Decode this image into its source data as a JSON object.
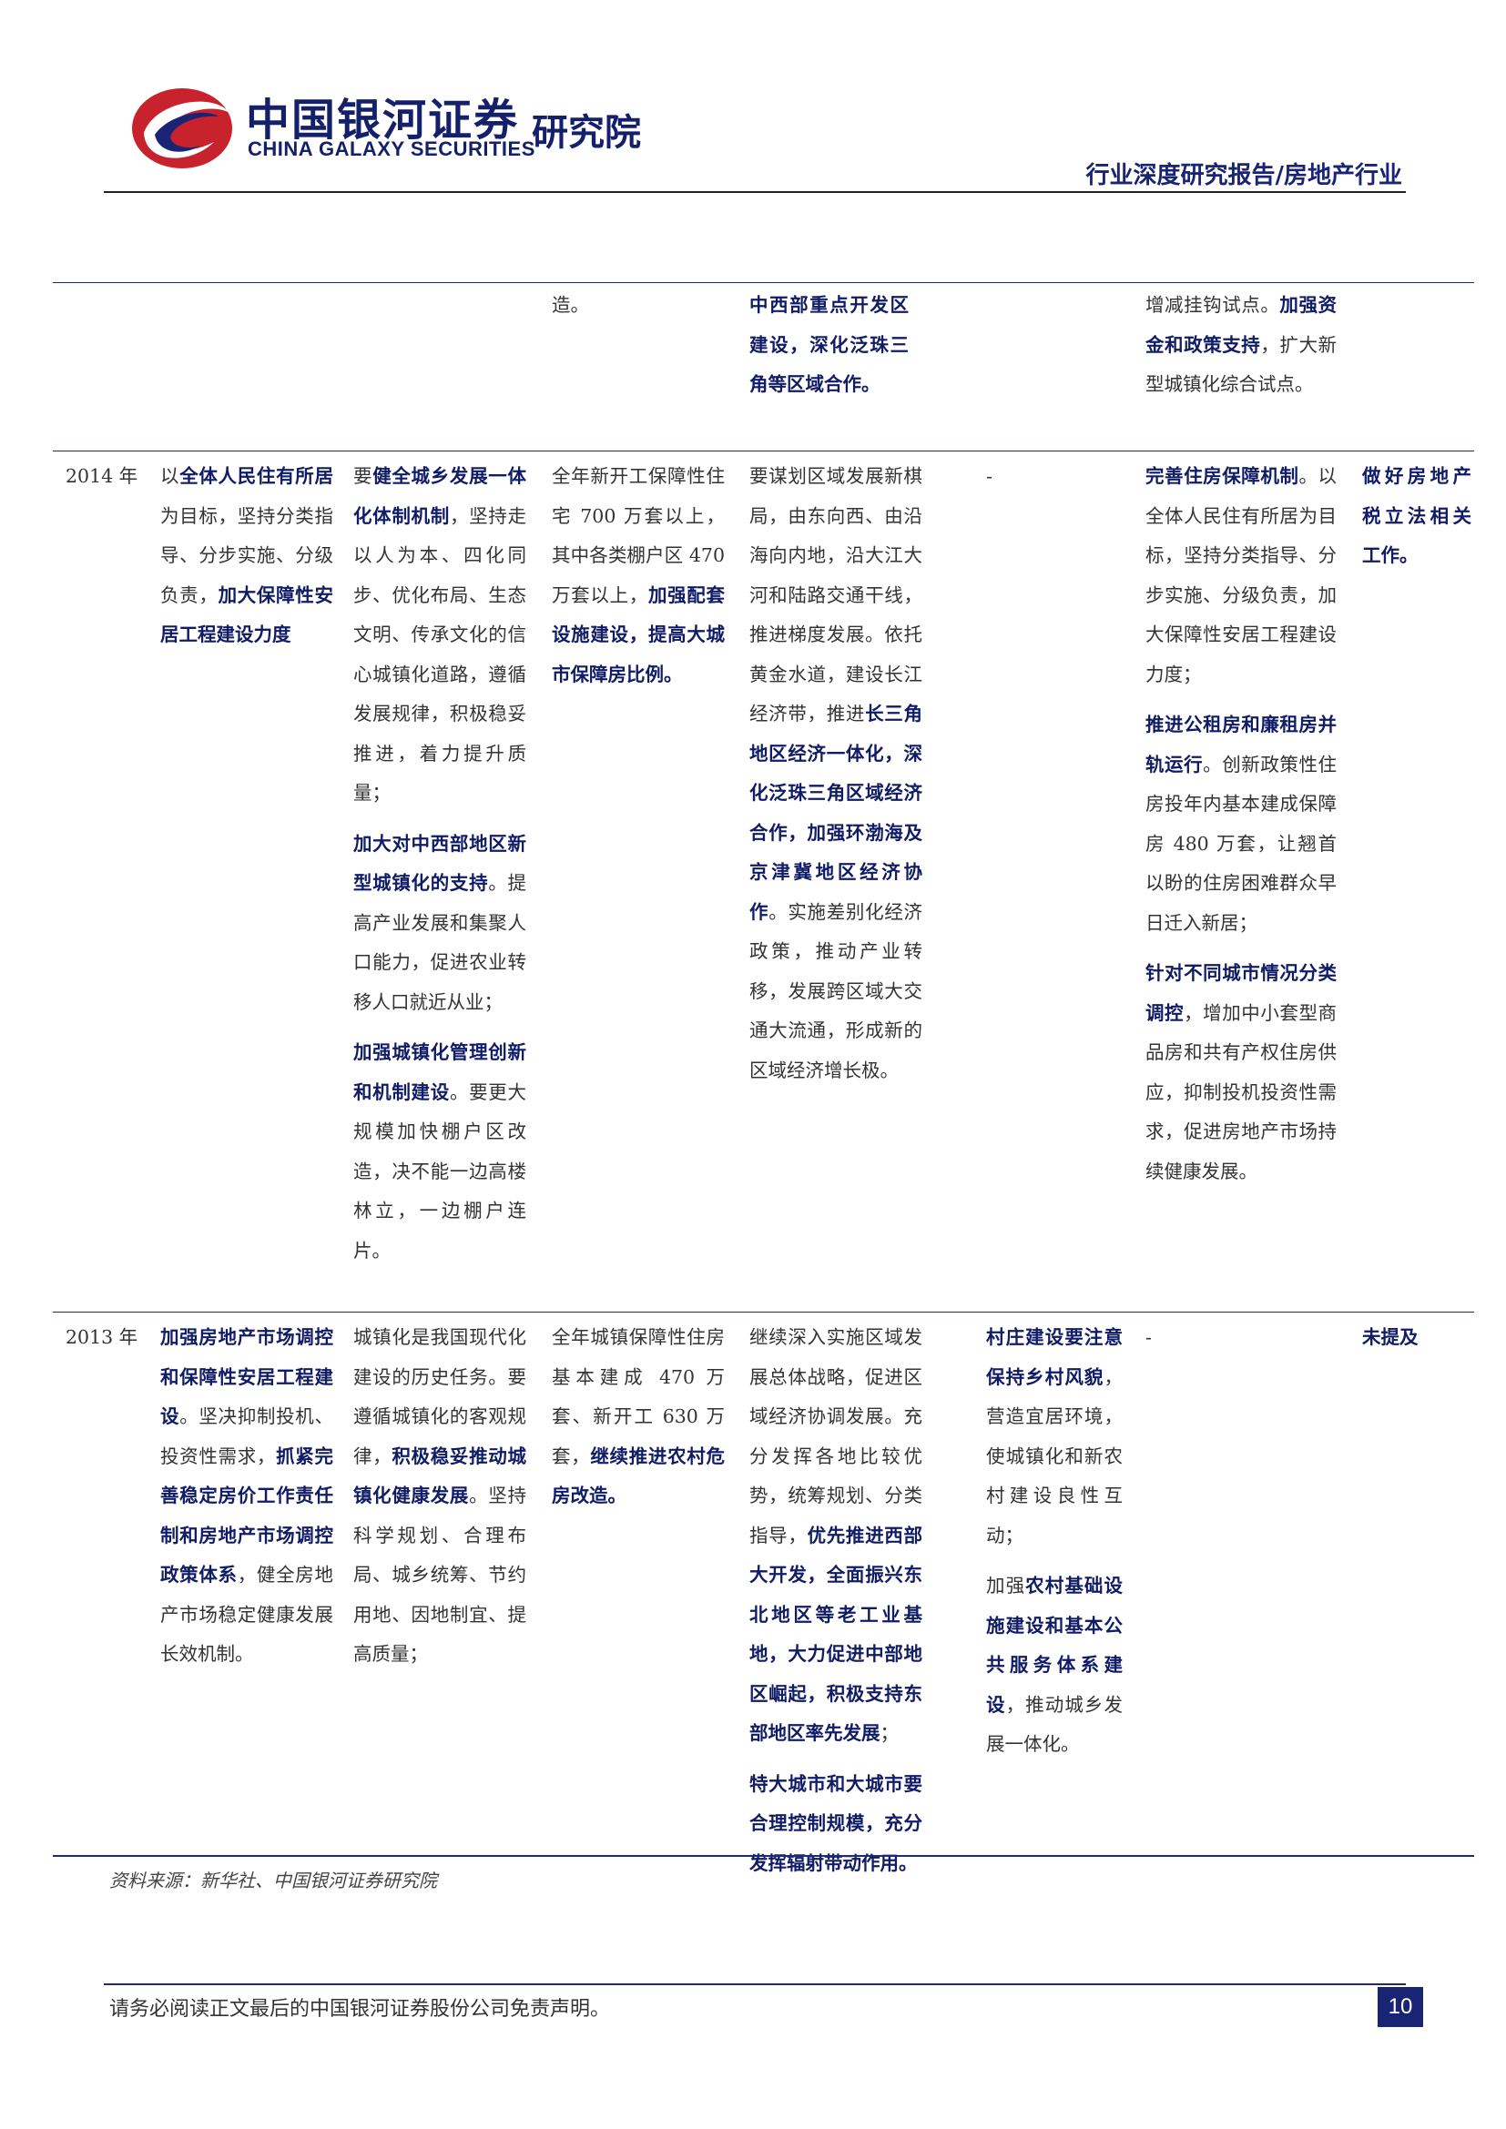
{
  "header": {
    "logo_cn": "中国银河证券",
    "logo_en": "CHINA GALAXY SECURITIES",
    "logo_inst": "研究院",
    "report_type": "行业深度研究报告/房地产行业"
  },
  "colors": {
    "brand_navy": "#1a2474",
    "logo_red": "#c8232c",
    "rule": "#1e2a78"
  },
  "table": {
    "cont_row": {
      "c3": "造。",
      "c4": "中西部重点开发区建设，深化泛珠三角等区域合作。",
      "c6_plain": "增减挂钩试点。",
      "c6_bold": "加强资金和政策支持",
      "c6_tail": "，扩大新型城镇化综合试点。"
    },
    "row_2014": {
      "year": "2014 年",
      "c1_a": "以",
      "c1_b": "全体人民住有所居",
      "c1_c": "为目标，坚持分类指导、分步实施、分级负责，",
      "c1_d": "加大保障性安居工程建设力度",
      "c2_p1_pre": "要",
      "c2_p1_bold": "健全城乡发展一体化体制机制",
      "c2_p1_tail": "，坚持走以人为本、四化同步、优化布局、生态文明、传承文化的信心城镇化道路，遵循发展规律，积极稳妥推进，着力提升质量；",
      "c2_p2_bold": "加大对中西部地区新型城镇化的支持",
      "c2_p2_tail": "。提高产业发展和集聚人口能力，促进农业转移人口就近从业；",
      "c2_p3_bold": "加强城镇化管理创新和机制建设",
      "c2_p3_tail": "。要更大规模加快棚户区改造，决不能一边高楼林立，一边棚户连片。",
      "c3_plain": "全年新开工保障性住宅 700 万套以上，其中各类棚户区 470 万套以上，",
      "c3_bold1": "加强配套设施建设",
      "c3_sep": "，",
      "c3_bold2": "提高大城市保障房比例",
      "c3_end": "。",
      "c4_plain": "要谋划区域发展新棋局，由东向西、由沿海向内地，沿大江大河和陆路交通干线，推进梯度发展。依托黄金水道，建设长江经济带，推进",
      "c4_bold": "长三角地区经济一体化，深化泛珠三角区域经济合作，加强环渤海及京津冀地区经济协作",
      "c4_tail": "。实施差别化经济政策，推动产业转移，发展跨区域大交通大流通，形成新的区域经济增长极。",
      "c5": "-",
      "c6_p1_bold": "完善住房保障机制",
      "c6_p1_tail": "。以全体人民住有所居为目标，坚持分类指导、分步实施、分级负责，加大保障性安居工程建设力度；",
      "c6_p2_bold": "推进公租房和廉租房并轨运行",
      "c6_p2_tail": "。创新政策性住房投年内基本建成保障房 480 万套，让翘首以盼的住房困难群众早日迁入新居；",
      "c6_p3_bold": "针对不同城市情况分类调控",
      "c6_p3_tail": "，增加中小套型商品房和共有产权住房供应，抑制投机投资性需求，促进房地产市场持续健康发展。",
      "c7": "做好房地产税立法相关工作。"
    },
    "row_2013": {
      "year": "2013 年",
      "c1_bold1": "加强房地产市场调控和保障性安居工程建设",
      "c1_mid": "。坚决抑制投机、投资性需求，",
      "c1_bold2": "抓紧完善稳定房价工作责任制和房地产市场调控政策体系",
      "c1_tail": "，健全房地产市场稳定健康发展长效机制。",
      "c2_pre": "城镇化是我国现代化建设的历史任务。要遵循城镇化的客观规律，",
      "c2_bold": "积极稳妥推动城镇化健康发展",
      "c2_tail": "。坚持科学规划、合理布局、城乡统筹、节约用地、因地制宜、提高质量；",
      "c3_plain": "全年城镇保障性住房基本建成 470 万套、新开工 630 万套，",
      "c3_bold": "继续推进农村危房改造",
      "c3_end": "。",
      "c4_p1_plain": "继续深入实施区域发展总体战略，促进区域经济协调发展。充分发挥各地比较优势，统筹规划、分类指导，",
      "c4_p1_bold": "优先推进西部大开发，全面振兴东北地区等老工业基地，大力促进中部地区崛起，积极支持东部地区率先发展",
      "c4_p1_end": "；",
      "c4_p2_bold": "特大城市和大城市要合理控制规模，充分发挥辐射带动作用",
      "c4_p2_end": "。",
      "c5_p1_bold": "村庄建设要注意保持乡村风貌",
      "c5_p1_tail": "，营造宜居环境，使城镇化和新农村建设良性互动；",
      "c5_p2_pre": "加强",
      "c5_p2_bold": "农村基础设施建设和基本公共服务体系建设",
      "c5_p2_tail": "，推动城乡发展一体化。",
      "c6": "-",
      "c7": "未提及"
    }
  },
  "source_note": "资料来源：新华社、中国银河证券研究院",
  "footer": {
    "disclaimer": "请务必阅读正文最后的中国银河证券股份公司免责声明。",
    "page_number": "10"
  }
}
